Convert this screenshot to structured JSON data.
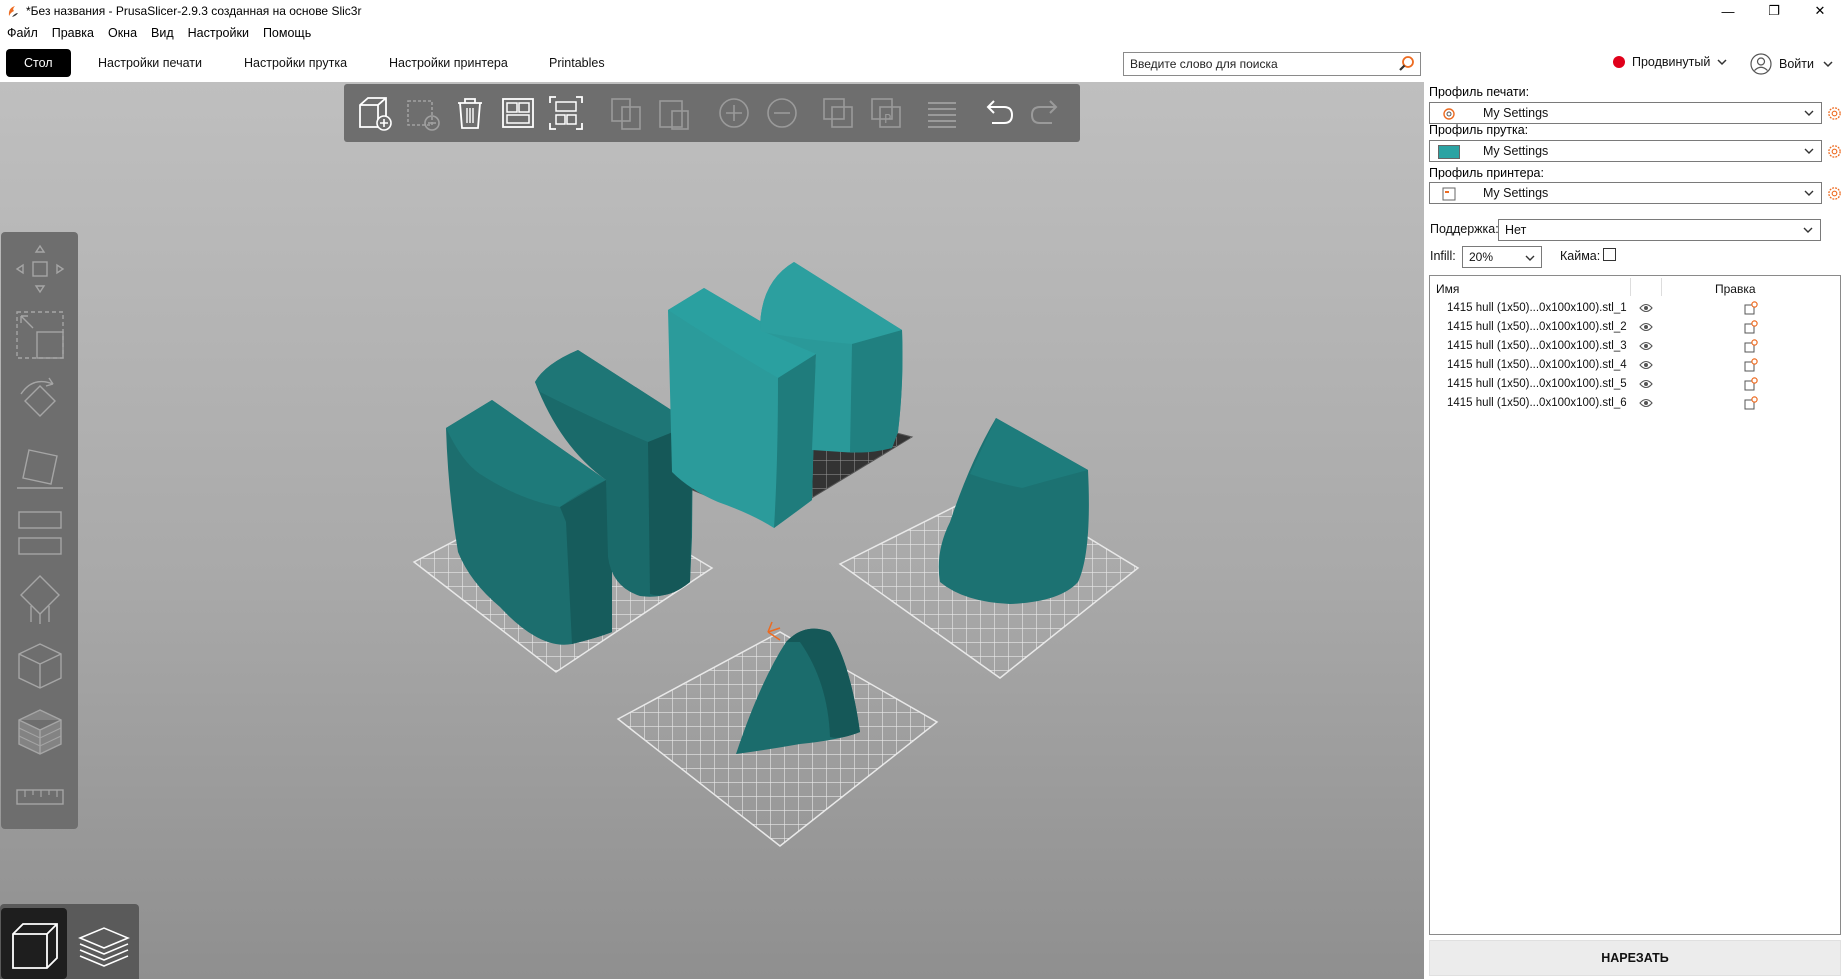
{
  "window": {
    "title": "*Без названия - PrusaSlicer-2.9.3 созданная на основе Slic3r",
    "icon": "prusa-logo-icon",
    "controls": {
      "minimize": "—",
      "maximize": "❐",
      "close": "✕"
    }
  },
  "menu": [
    "Файл",
    "Правка",
    "Окна",
    "Вид",
    "Настройки",
    "Помощь"
  ],
  "tabs": {
    "plater": "Стол",
    "print_settings": "Настройки печати",
    "filament_settings": "Настройки прутка",
    "printer_settings": "Настройки принтера",
    "printables": "Printables"
  },
  "search": {
    "placeholder": "Введите слово для поиска",
    "icon": "search-icon"
  },
  "mode": {
    "label": "Продвинутый",
    "color": "#e0001a"
  },
  "account": {
    "label": "Войти",
    "icon": "user-icon"
  },
  "toolbar_top": [
    "add-icon",
    "delete-icon",
    "delete-all-icon",
    "arrange-icon",
    "arrange-selection-icon",
    "copy-icon",
    "paste-icon",
    "instance-add-icon",
    "instance-remove-icon",
    "split-objects-icon",
    "split-parts-icon",
    "layers-icon",
    "undo-icon",
    "redo-icon"
  ],
  "toolbar_left": [
    "move-icon",
    "scale-icon",
    "rotate-icon",
    "place-on-face-icon",
    "cut-icon",
    "support-paint-icon",
    "seam-paint-icon",
    "mmu-paint-icon",
    "measure-icon"
  ],
  "view_switch": [
    "3d-view-icon",
    "preview-icon"
  ],
  "colors": {
    "model": "#2a9a9a",
    "model_dark": "#1a6f6f",
    "accent": "#ed6b21"
  },
  "sidebar": {
    "print_profile_label": "Профиль печати:",
    "print_profile_value": "My Settings",
    "filament_profile_label": "Профиль прутка:",
    "filament_profile_value": "My Settings",
    "filament_color": "#2ba3a3",
    "printer_profile_label": "Профиль принтера:",
    "printer_profile_value": "My Settings",
    "support_label": "Поддержка:",
    "support_value": "Нет",
    "infill_label": "Infill:",
    "infill_value": "20%",
    "brim_label": "Кайма:",
    "brim_checked": false
  },
  "object_list": {
    "col_name": "Имя",
    "col_edit": "Правка",
    "items": [
      "1415 hull (1x50)...0x100x100).stl_1",
      "1415 hull (1x50)...0x100x100).stl_2",
      "1415 hull (1x50)...0x100x100).stl_3",
      "1415 hull (1x50)...0x100x100).stl_4",
      "1415 hull (1x50)...0x100x100).stl_5",
      "1415 hull (1x50)...0x100x100).stl_6"
    ]
  },
  "slice_button": "НАРЕЗАТЬ"
}
